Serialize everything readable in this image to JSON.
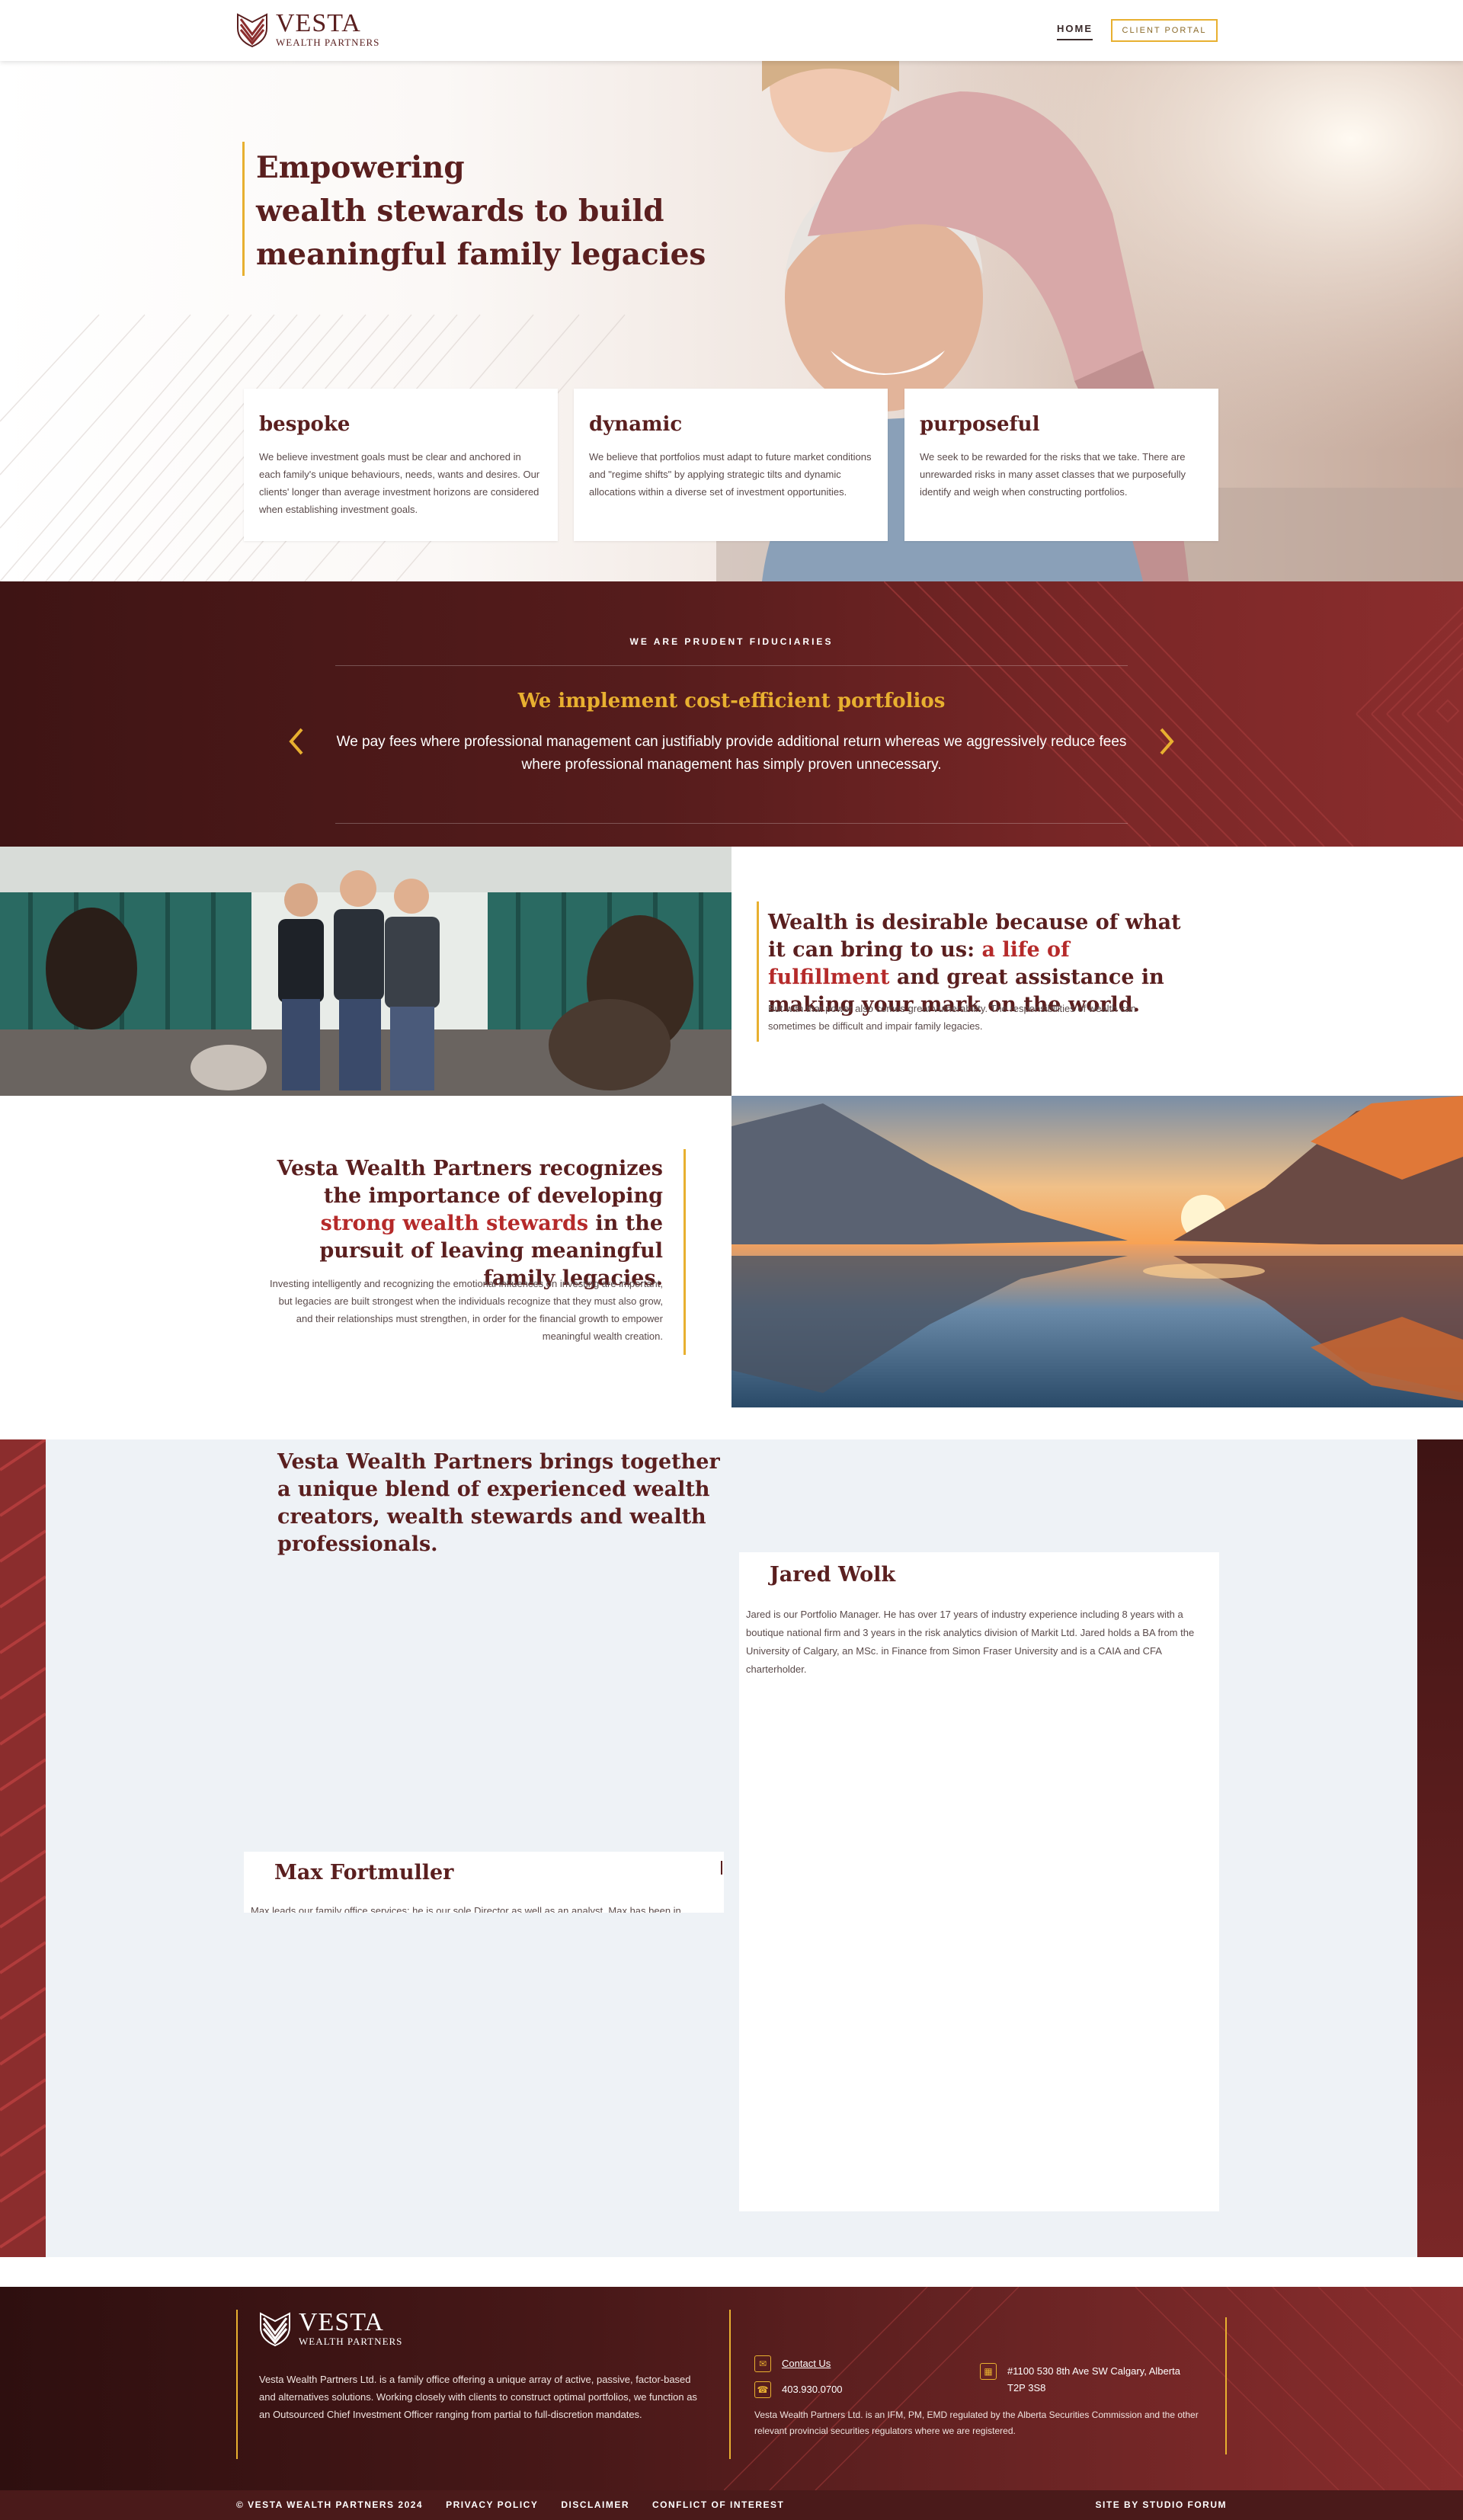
{
  "brand": {
    "name": "VESTA",
    "sub": "WEALTH PARTNERS",
    "primary": "#5a1f1f",
    "accent": "#e8b030",
    "highlight": "#b52a2a"
  },
  "nav": {
    "home": "HOME",
    "portal": "CLIENT PORTAL"
  },
  "hero": {
    "title_lines": [
      "Empowering",
      "wealth stewards to build",
      "meaningful family legacies"
    ],
    "cards": [
      {
        "title": "bespoke",
        "text": "We believe investment goals must be clear and anchored in each family's unique behaviours, needs, wants and desires. Our clients' longer than average investment horizons are considered when establishing investment goals."
      },
      {
        "title": "dynamic",
        "text": "We believe that portfolios must adapt to future market conditions and \"regime shifts\" by applying strategic tilts and dynamic allocations within a diverse set of investment opportunities."
      },
      {
        "title": "purposeful",
        "text": "We seek to be rewarded for the risks that we take. There are unrewarded risks in many asset classes that we purposefully identify and weigh when constructing portfolios."
      }
    ]
  },
  "fiduciary": {
    "kicker": "WE ARE PRUDENT FIDUCIARIES",
    "title": "We implement cost-efficient portfolios",
    "text": "We pay fees where professional management can justifiably provide additional return whereas we aggressively reduce fees where professional management has simply proven unnecessary."
  },
  "row1": {
    "heading_pre": "Wealth is desirable because of what it can bring to us: ",
    "heading_accent": "a life of fulfillment",
    "heading_post": " and great assistance in making  your mark on the world.",
    "text": "But with that power also comes great vulnerability. The responsibilities of wealth can sometimes be difficult and impair family legacies."
  },
  "row2": {
    "heading_pre": "Vesta Wealth Partners recognizes the importance of developing ",
    "heading_accent": "strong wealth stewards",
    "heading_post": " in the pursuit of leaving meaningful family legacies.",
    "text": "Investing intelligently and recognizing the emotional influences on investing are important, but legacies are built strongest when the individuals recognize that they must also grow, and their relationships must strengthen, in order for the financial growth to empower meaningful wealth creation."
  },
  "team": {
    "heading": "Vesta Wealth Partners brings together a unique blend of experienced wealth creators, wealth stewards and wealth professionals.",
    "jared": {
      "name": "Jared Wolk",
      "bio": "Jared is our Portfolio Manager. He has over 17 years of industry experience including 8 years with a boutique national firm and 3 years in the risk analytics division of Markit Ltd. Jared holds a BA from the University of Calgary, an MSc. in Finance from Simon Fraser University and is a CAIA and CFA charterholder."
    },
    "max": {
      "name": "Max Fortmuller",
      "bio": "Max leads our family office services; he is our sole Director as well as an analyst. Max has been in"
    }
  },
  "footer": {
    "description": "Vesta Wealth Partners Ltd. is a family office offering a unique array of active, passive, factor-based and alternatives solutions. Working closely with clients to construct optimal portfolios, we function as an Outsourced Chief Investment Officer ranging from partial to full-discretion mandates.",
    "contact": "Contact Us",
    "phone": "403.930.0700",
    "address_line1": "#1100 530 8th Ave SW Calgary, Alberta",
    "address_line2": "T2P 3S8",
    "regulatory": "Vesta Wealth Partners Ltd. is an IFM, PM, EMD regulated by the Alberta Securities Commission and the other relevant provincial securities regulators where we are registered."
  },
  "bottom": {
    "copyright": "© VESTA WEALTH PARTNERS 2024",
    "privacy": "PRIVACY POLICY",
    "disclaimer": "DISCLAIMER",
    "conflict": "CONFLICT OF INTEREST",
    "credit": "SITE BY STUDIO FORUM"
  }
}
